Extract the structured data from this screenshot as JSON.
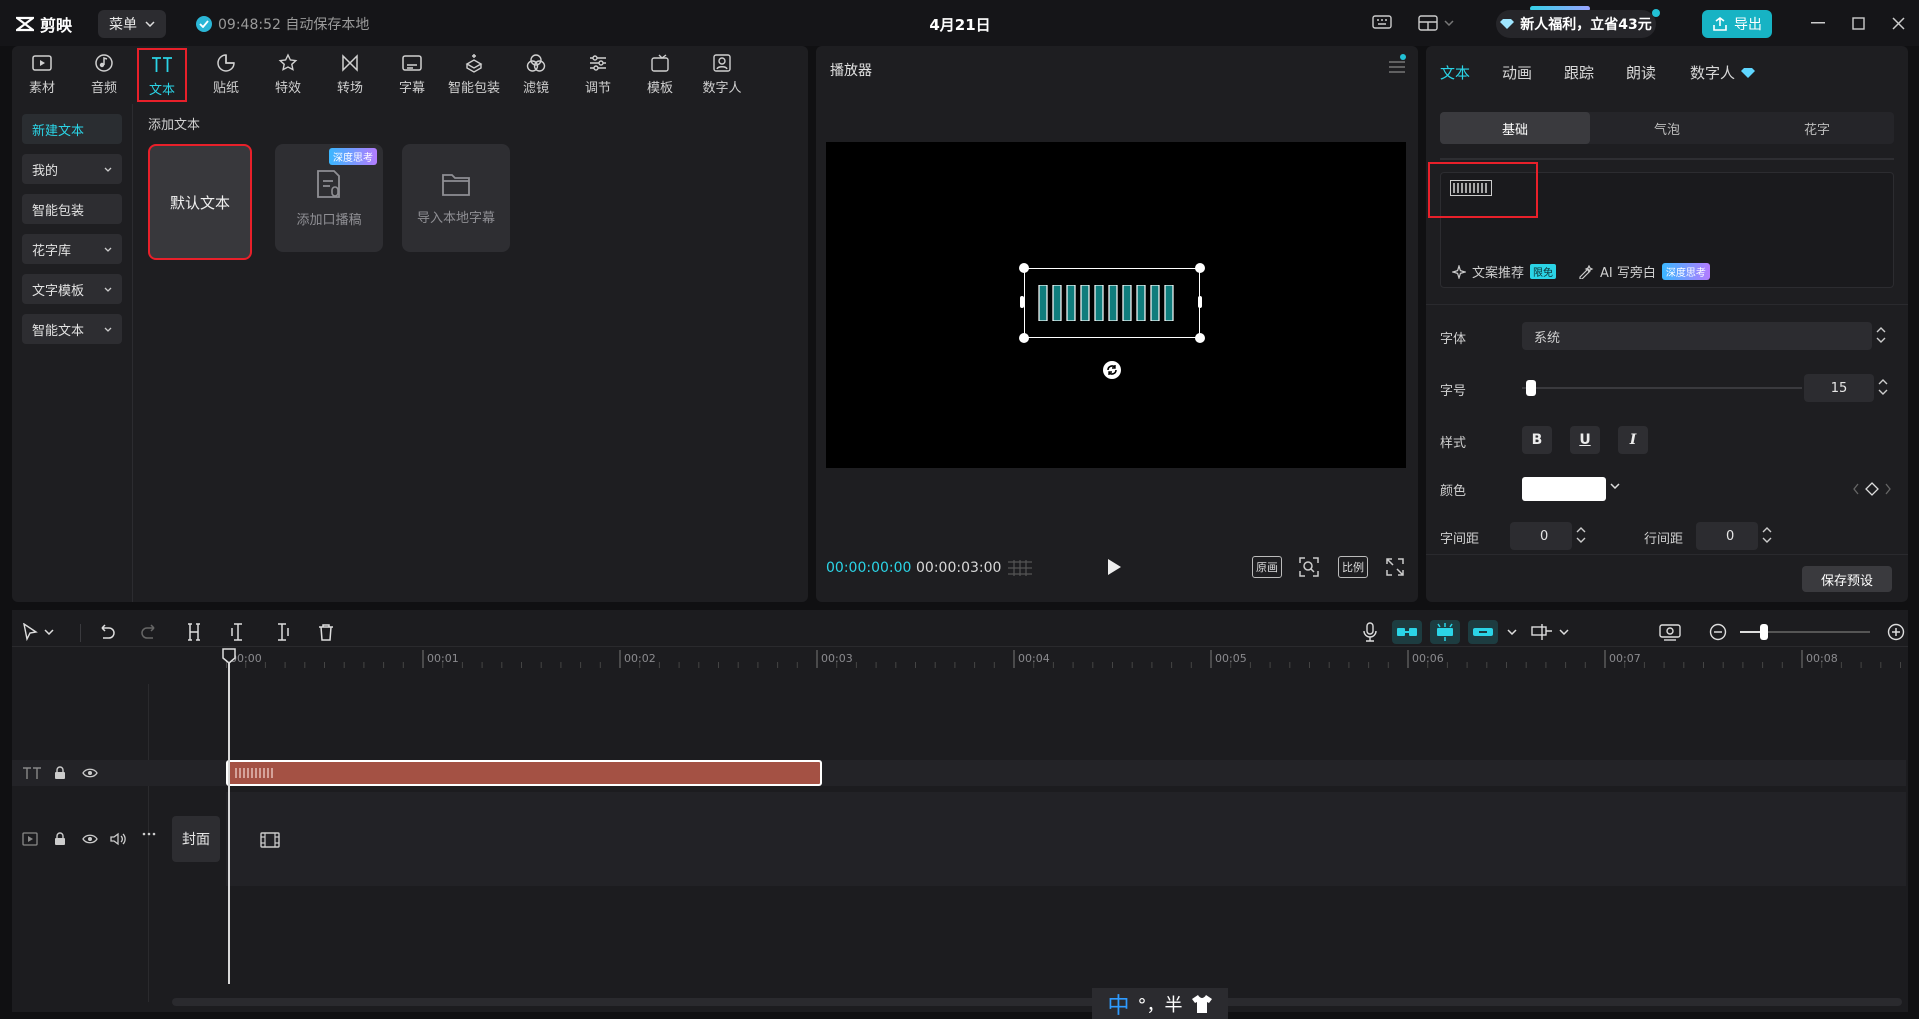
{
  "app": {
    "name": "剪映",
    "menu_label": "菜单",
    "autosave": "09:48:52 自动保存本地",
    "project_title": "4月21日",
    "promo": "新人福利，立省43元",
    "export_label": "导出"
  },
  "toolbar_tabs": [
    {
      "label": "素材",
      "icon": "media-icon"
    },
    {
      "label": "音频",
      "icon": "audio-icon"
    },
    {
      "label": "文本",
      "icon": "text-icon",
      "active": true
    },
    {
      "label": "贴纸",
      "icon": "sticker-icon"
    },
    {
      "label": "特效",
      "icon": "effects-icon"
    },
    {
      "label": "转场",
      "icon": "transition-icon"
    },
    {
      "label": "字幕",
      "icon": "subtitle-icon"
    },
    {
      "label": "智能包装",
      "icon": "smart-package-icon"
    },
    {
      "label": "滤镜",
      "icon": "filter-icon"
    },
    {
      "label": "调节",
      "icon": "adjust-icon"
    },
    {
      "label": "模板",
      "icon": "template-icon"
    },
    {
      "label": "数字人",
      "icon": "digital-human-icon"
    }
  ],
  "sidebar": {
    "items": [
      {
        "label": "新建文本",
        "active": true
      },
      {
        "label": "我的",
        "dropdown": true
      },
      {
        "label": "智能包装",
        "dropdown": false
      },
      {
        "label": "花字库",
        "dropdown": true
      },
      {
        "label": "文字模板",
        "dropdown": true
      },
      {
        "label": "智能文本",
        "dropdown": true
      }
    ]
  },
  "content": {
    "section_label": "添加文本",
    "cards": [
      {
        "label": "默认文本"
      },
      {
        "label": "添加口播稿",
        "badge": "深度思考"
      },
      {
        "label": "导入本地字幕"
      }
    ]
  },
  "player": {
    "title": "播放器",
    "current_time": "00:00:00:00",
    "total_time": "00:00:03:00",
    "buttons": [
      "原画",
      "比例"
    ]
  },
  "properties": {
    "tabs": [
      "文本",
      "动画",
      "跟踪",
      "朗读",
      "数字人"
    ],
    "subtabs": [
      "基础",
      "气泡",
      "花字"
    ],
    "ai_actions": [
      {
        "label": "文案推荐",
        "badge": "限免"
      },
      {
        "label": "AI 写旁白",
        "badge": "深度思考"
      }
    ],
    "font_label": "字体",
    "font_value": "系统",
    "size_label": "字号",
    "size_value": "15",
    "size_slider_fraction": 0.02,
    "style_label": "样式",
    "style_buttons": [
      "B",
      "U",
      "I"
    ],
    "color_label": "颜色",
    "color_value": "#ffffff",
    "letter_spacing_label": "字间距",
    "letter_spacing": "0",
    "line_spacing_label": "行间距",
    "line_spacing": "0",
    "save_preset": "保存预设"
  },
  "timeline": {
    "ruler": [
      "00:00",
      "00:01",
      "00:02",
      "00:03",
      "00:04",
      "00:05",
      "00:06",
      "00:07",
      "00:08"
    ],
    "cover_label": "封面"
  },
  "ime": {
    "mode": "中",
    "punct": "°，半"
  },
  "colors": {
    "accent": "#2bd4e6",
    "clip": "#a45144",
    "highlight_box": "#e8202a"
  }
}
